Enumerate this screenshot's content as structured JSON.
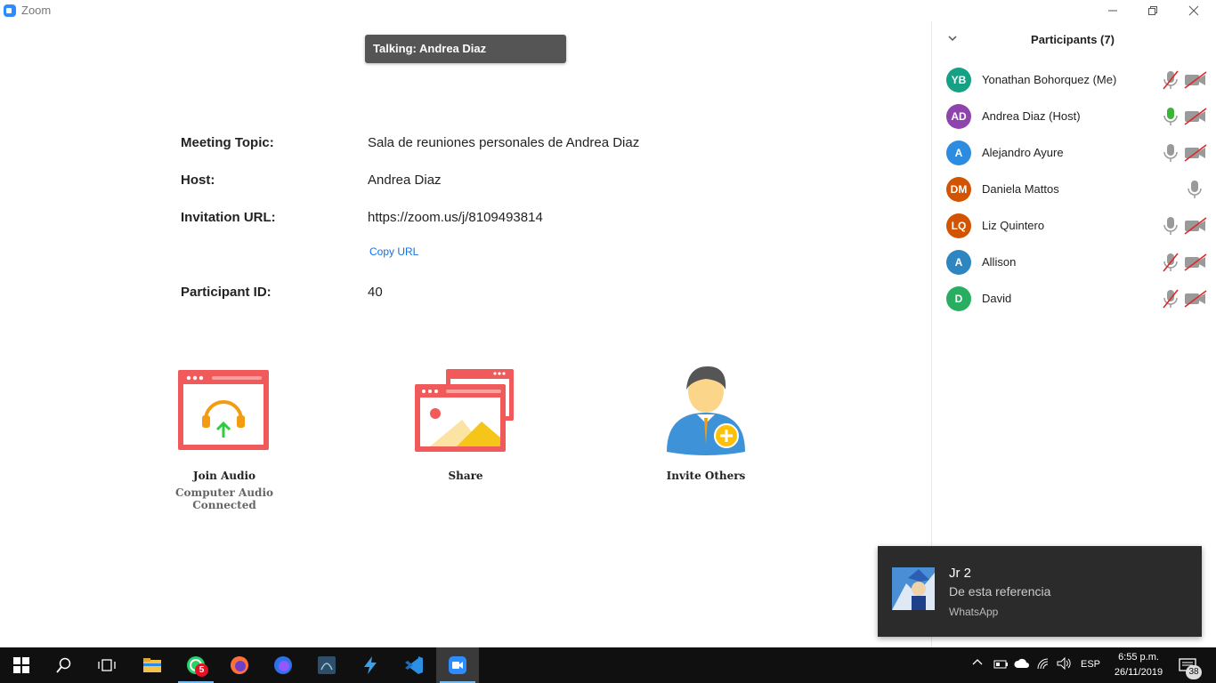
{
  "window": {
    "title": "Zoom"
  },
  "talking": "Talking: Andrea Diaz",
  "info": {
    "topic_label": "Meeting Topic:",
    "topic_value": "Sala de reuniones personales de Andrea Diaz",
    "host_label": "Host:",
    "host_value": "Andrea Diaz",
    "url_label": "Invitation URL:",
    "url_value": "https://zoom.us/j/8109493814",
    "copy_url": "Copy URL",
    "pid_label": "Participant ID:",
    "pid_value": "40"
  },
  "actions": {
    "join_audio": "Join Audio",
    "join_audio_sub": "Computer Audio Connected",
    "share": "Share",
    "invite": "Invite Others"
  },
  "participants": {
    "title": "Participants (7)",
    "list": [
      {
        "initials": "YB",
        "name": "Yonathan Bohorquez (Me)",
        "color": "#16A085",
        "mic": "muted",
        "video": "off"
      },
      {
        "initials": "AD",
        "name": "Andrea Diaz (Host)",
        "color": "#8E44AD",
        "mic": "active",
        "video": "off"
      },
      {
        "initials": "A",
        "name": "Alejandro Ayure",
        "color": "#2D8CDF",
        "mic": "on",
        "video": "off"
      },
      {
        "initials": "DM",
        "name": "Daniela Mattos",
        "color": "#D35400",
        "mic": "on",
        "video": "none"
      },
      {
        "initials": "LQ",
        "name": "Liz Quintero",
        "color": "#D35400",
        "mic": "on",
        "video": "off"
      },
      {
        "initials": "A",
        "name": "Allison",
        "color": "#2E86C1",
        "mic": "muted",
        "video": "off"
      },
      {
        "initials": "D",
        "name": "David",
        "color": "#27AE60",
        "mic": "muted",
        "video": "off"
      }
    ]
  },
  "toast": {
    "title": "Jr 2",
    "body": "De esta referencia",
    "app": "WhatsApp"
  },
  "taskbar": {
    "whatsapp_badge": "5",
    "lang": "ESP",
    "time": "6:55 p.m.",
    "date": "26/11/2019",
    "notifications": "38"
  },
  "colors": {
    "accent": "#2D8CFF",
    "link": "#0E72ED",
    "mic_active": "#3CB43C",
    "muted_red": "#E02828"
  }
}
